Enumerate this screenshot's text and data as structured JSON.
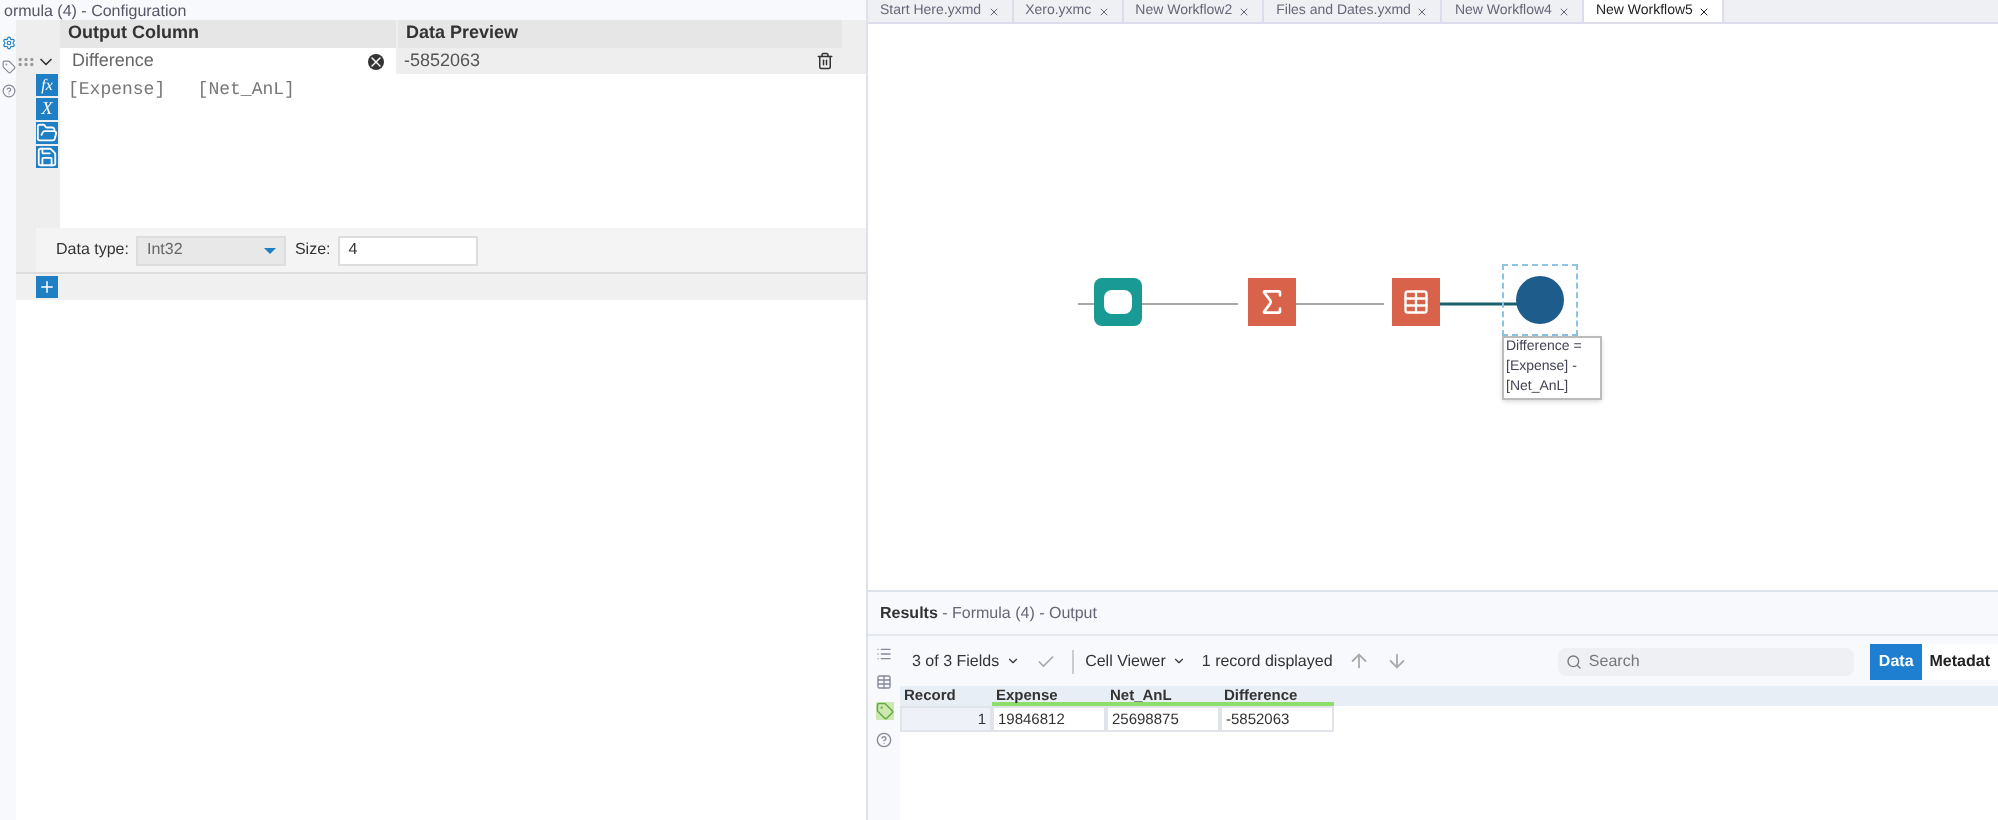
{
  "config_panel": {
    "title": "ormula (4) - Configuration",
    "columns": [
      "Output Column",
      "Data Preview"
    ],
    "row": {
      "expanded": true,
      "output_column": "Difference",
      "preview": "-5852063"
    },
    "expression": "[Expense]   [Net_AnL]",
    "tool_glyphs": [
      "fx",
      "X"
    ],
    "data_type_label": "Data type:",
    "data_type": "Int32",
    "size_label": "Size:",
    "size": "4"
  },
  "tabs": [
    {
      "label": "Start Here.yxmd",
      "selected": false
    },
    {
      "label": "Xero.yxmc",
      "selected": false
    },
    {
      "label": "New Workflow2",
      "selected": false
    },
    {
      "label": "Files and Dates.yxmd",
      "selected": false
    },
    {
      "label": "New Workflow4",
      "selected": false
    },
    {
      "label": "New Workflow5",
      "selected": true
    }
  ],
  "canvas": {
    "annotation": [
      "Difference =",
      "[Expense] -",
      "[Net_AnL]"
    ]
  },
  "results": {
    "title": "Results",
    "subtitle": " - Formula (4) - Output",
    "fields": "3 of 3 Fields",
    "viewer": "Cell Viewer",
    "records": "1 record displayed",
    "search_placeholder": "Search",
    "views": [
      {
        "label": "Data",
        "selected": true
      },
      {
        "label": "Metadat",
        "selected": false
      }
    ],
    "columns": [
      "Record",
      "Expense",
      "Net_AnL",
      "Difference"
    ],
    "rows": [
      [
        "1",
        "19846812",
        "25698875",
        "-5852063"
      ]
    ]
  }
}
